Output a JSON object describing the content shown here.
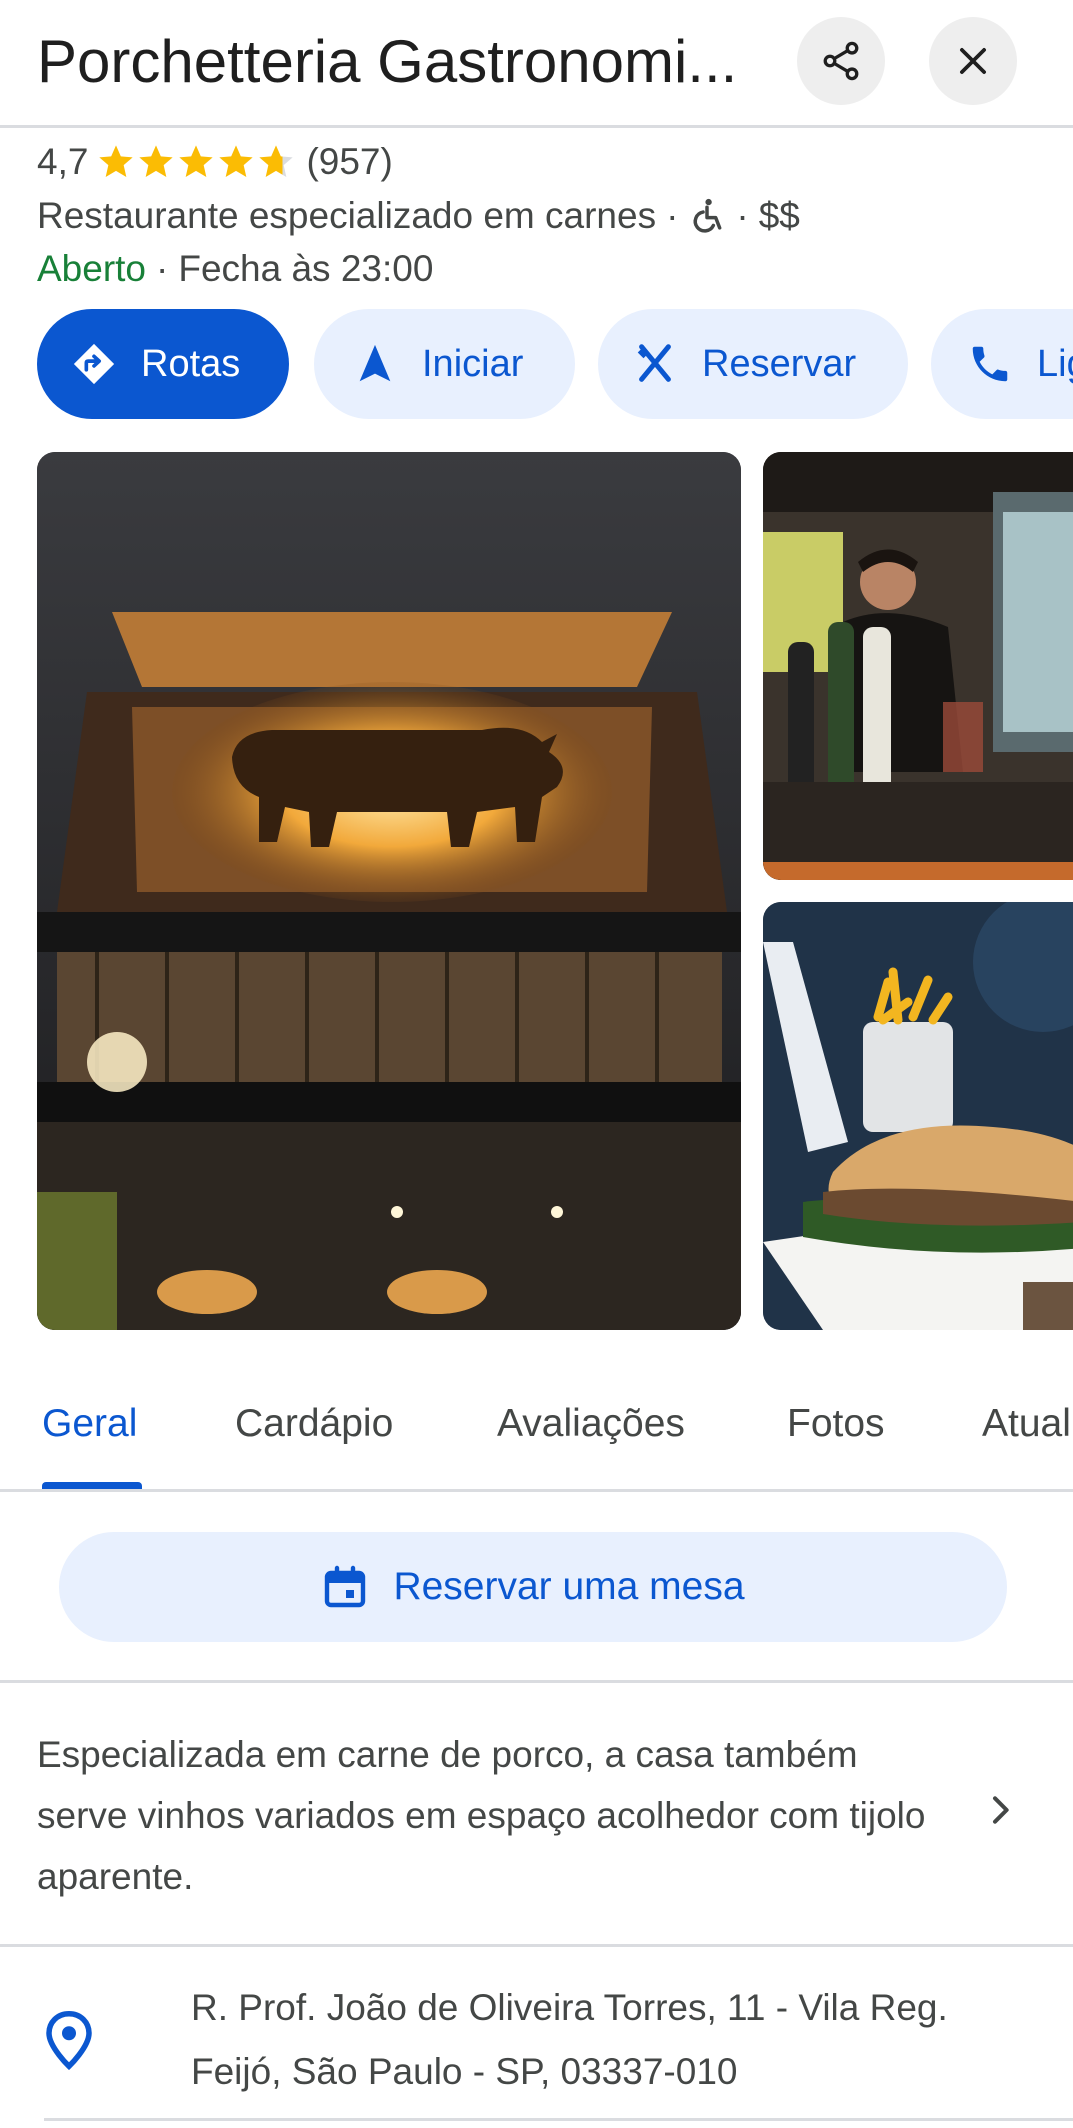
{
  "header": {
    "title": "Porchetteria Gastronomi...",
    "share_icon": "share-icon",
    "close_icon": "close-icon"
  },
  "summary": {
    "rating": "4,7",
    "rating_value": 4.7,
    "stars_max": 5,
    "reviews_count": "(957)",
    "category": "Restaurante especializado em carnes",
    "separator": "·",
    "accessibility_icon": "wheelchair-icon",
    "price": "$$",
    "status_open": "Aberto",
    "status_close": "Fecha às 23:00"
  },
  "actions": [
    {
      "label": "Rotas",
      "icon": "directions-icon"
    },
    {
      "label": "Iniciar",
      "icon": "navigation-arrow-icon"
    },
    {
      "label": "Reservar",
      "icon": "utensils-icon"
    },
    {
      "label": "Ligar",
      "icon": "phone-icon"
    }
  ],
  "tabs": [
    {
      "label": "Geral",
      "active": true
    },
    {
      "label": "Cardápio",
      "active": false
    },
    {
      "label": "Avaliações",
      "active": false
    },
    {
      "label": "Fotos",
      "active": false
    },
    {
      "label": "Atualizações",
      "active": false
    }
  ],
  "reserve_table": {
    "label": "Reservar uma mesa",
    "icon": "calendar-icon"
  },
  "description": "Especializada em carne de porco, a casa também serve vinhos variados em espaço acolhedor com tijolo aparente.",
  "address": {
    "line1": "R. Prof. João de Oliveira Torres, 11 - Vila Reg.",
    "line2": "Feijó, São Paulo - SP, 03337-010",
    "icon": "location-pin-icon"
  },
  "colors": {
    "accent": "#0b57d0",
    "accent_light": "#e8f0fe",
    "open_green": "#188038",
    "star": "#fbbc04"
  }
}
